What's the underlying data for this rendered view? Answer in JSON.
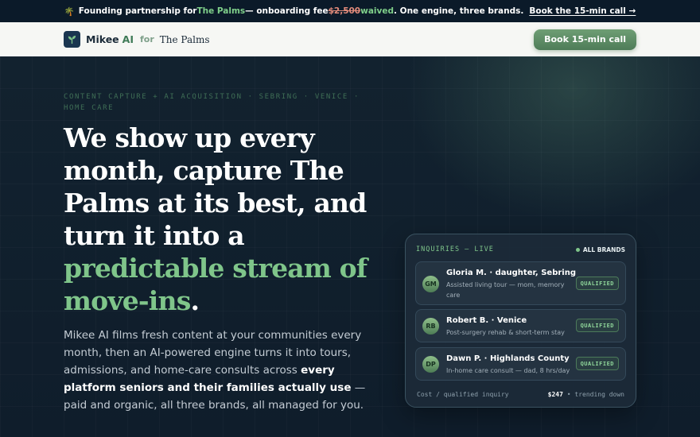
{
  "announcement": {
    "icon": "palm-tree-icon",
    "text_before": "Founding partnership for ",
    "client_name": "The Palms",
    "text_middle": " — onboarding fee ",
    "old_fee": "$2,500",
    "waived": " waived",
    "text_after": ". One engine, three brands.",
    "cta_label": "Book the 15-min call →"
  },
  "nav": {
    "brand_name": "Mikee",
    "brand_ai": "AI",
    "for_label": "for",
    "client_name": "The Palms",
    "cta_label": "Book 15-min call"
  },
  "hero": {
    "eyebrow": "CONTENT CAPTURE + AI ACQUISITION · SEBRING · VENICE · HOME CARE",
    "headline_white": "We show up every month, capture The Palms at its best, and turn it into a ",
    "headline_green": "predictable stream of move-ins",
    "headline_end": ".",
    "sub_before": "Mikee AI films fresh content at your communities every month, then an AI-powered engine turns it into tours, admissions, and home-care consults across ",
    "sub_bold": "every platform seniors and their families actually use",
    "sub_after": " — paid and organic, all three brands, all managed for you."
  },
  "card": {
    "title": "INQUIRIES — LIVE",
    "status": "ALL BRANDS",
    "inquiries": [
      {
        "initials": "GM",
        "name": "Gloria M. · daughter, Sebring",
        "desc": "Assisted living tour — mom, memory care",
        "badge": "QUALIFIED"
      },
      {
        "initials": "RB",
        "name": "Robert B. · Venice",
        "desc": "Post-surgery rehab & short-term stay",
        "badge": "QUALIFIED"
      },
      {
        "initials": "DP",
        "name": "Dawn P. · Highlands County",
        "desc": "In-home care consult — dad, 8 hrs/day",
        "badge": "QUALIFIED"
      }
    ],
    "footer_label": "Cost / qualified inquiry",
    "footer_value": "$247",
    "footer_trend": " • trending down"
  },
  "colors": {
    "accent_green": "#7fc58a",
    "dark_bg": "#0f1e2e",
    "nav_bg": "#f6f7f4",
    "strike_red": "#e08a7a"
  }
}
